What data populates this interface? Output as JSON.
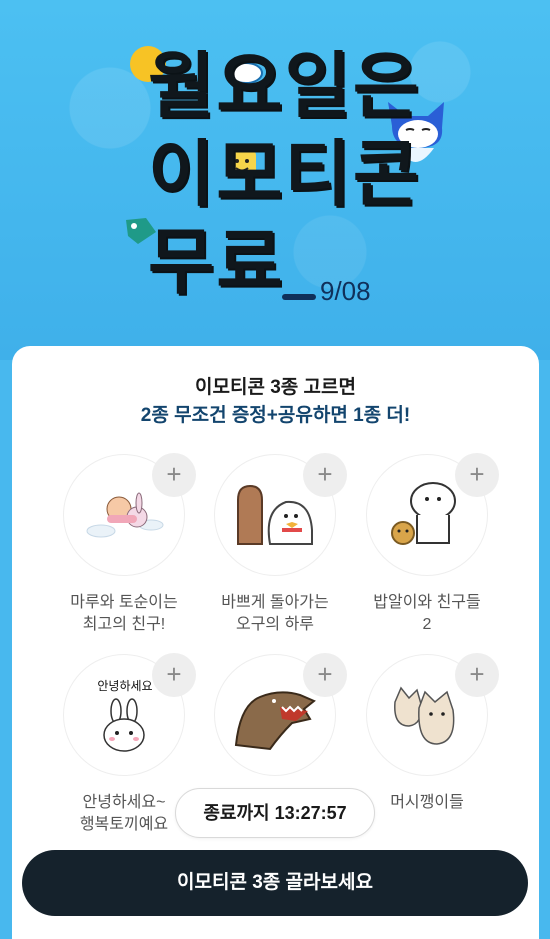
{
  "hero": {
    "title_lines": [
      "월요일은",
      "이모티콘",
      "무료"
    ],
    "date": "9/08"
  },
  "promo": {
    "headline": "이모티콘 3종 고르면",
    "subheadline": "2종 무조건 증정+공유하면 1종 더!"
  },
  "items": [
    {
      "label": "마루와 토순이는\n최고의 친구!",
      "icon": "maru-and-tosuni-sticker"
    },
    {
      "label": "바쁘게 돌아가는\n오구의 하루",
      "icon": "ogu-door-sticker"
    },
    {
      "label": "밥알이와 친구들\n2",
      "icon": "babal-friends-sticker"
    },
    {
      "label": "안녕하세요~\n행복토끼예요",
      "icon": "happy-rabbit-sticker",
      "sticker_text": "안녕하세요"
    },
    {
      "label": "",
      "icon": "dinosaur-sticker"
    },
    {
      "label": "머시깽이들",
      "icon": "dogs-sticker"
    }
  ],
  "plus_symbol": "+",
  "timer": "종료까지 13:27:57",
  "cta_label": "이모티콘 3종 골라보세요",
  "colors": {
    "background": "#48b8ee",
    "cta": "#15222c",
    "subheadline": "#13456e"
  }
}
